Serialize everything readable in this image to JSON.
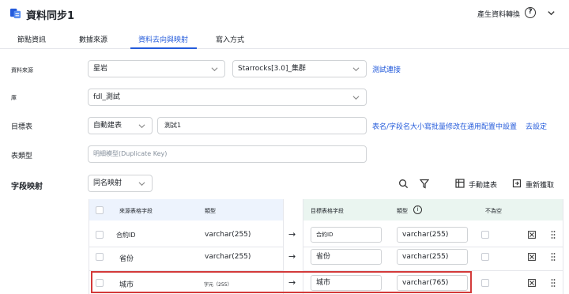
{
  "header": {
    "title": "資料同步1",
    "generate_label": "產生資料轉換",
    "help_icon": "?"
  },
  "tabs": [
    {
      "label": "節點資訊"
    },
    {
      "label": "數據來源"
    },
    {
      "label": "資料去向與映射",
      "active": true
    },
    {
      "label": "寫入方式"
    }
  ],
  "form": {
    "datasource_label": "資料來源",
    "datasource_type": "星岩",
    "datasource_cluster": "Starrocks[3.0]_集群",
    "test_connection": "測試連接",
    "database_label": "庫",
    "database_value": "fdl_測試",
    "target_table_label": "目標表",
    "auto_create_option": "自動建表",
    "target_table_value": "測試1",
    "batch_modify_tip": "表名/字段名大小寫批量修改在通用配置中設置",
    "go_setting": "去設定",
    "table_type_label": "表類型",
    "table_type_value": "明細模型(Duplicate Key)",
    "field_mapping_label": "字段映射",
    "mapping_mode": "同名映射"
  },
  "toolbar": {
    "manual_create": "手動建表",
    "refresh": "重新獲取"
  },
  "table": {
    "headers": {
      "source_field": "來源表格字段",
      "source_type": "類型",
      "target_field": "目標表格字段",
      "target_type": "類型",
      "not_null": "不為空"
    },
    "rows": [
      {
        "source_field": "合約ID",
        "source_type": "varchar(255)",
        "target_field": "合約ID",
        "target_type": "varchar(255)"
      },
      {
        "source_field": "省份",
        "source_type": "varchar(255)",
        "target_field": "省份",
        "target_type": "varchar(255)"
      },
      {
        "source_field": "城市",
        "source_type": "字元（255）",
        "target_field": "城市",
        "target_type": "varchar(765)"
      }
    ],
    "arrow": "→"
  },
  "colors": {
    "accent": "#245bdb",
    "source_header_bg": "#edf3fd",
    "target_header_bg": "#eaf5f0",
    "highlight": "#d33a3a"
  }
}
